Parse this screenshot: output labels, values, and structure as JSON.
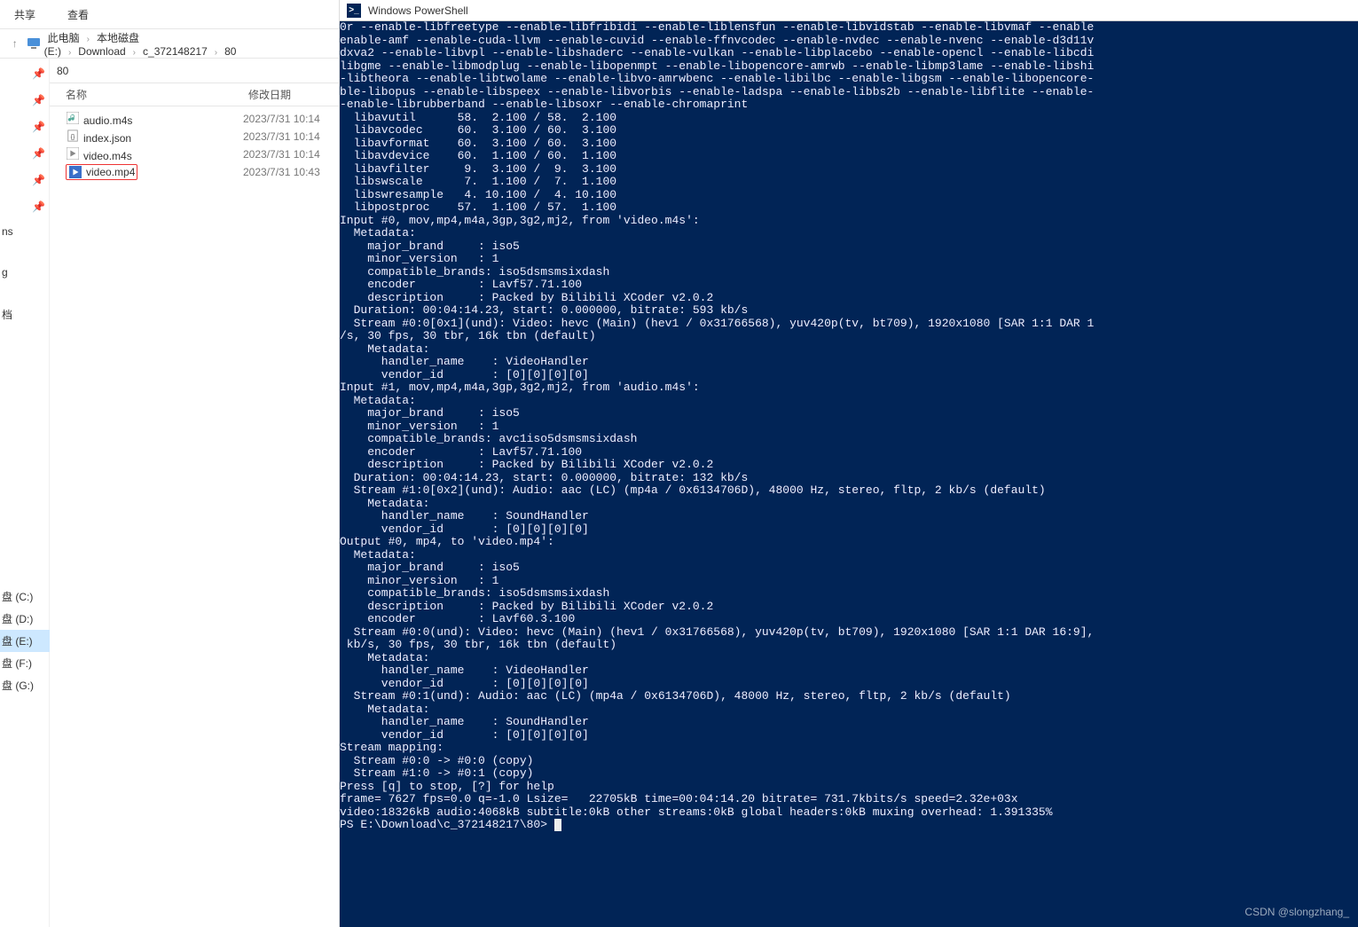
{
  "explorer": {
    "ribbon": {
      "share": "共享",
      "view": "查看"
    },
    "breadcrumbs": [
      "此电脑",
      "本地磁盘 (E:)",
      "Download",
      "c_372148217",
      "80"
    ],
    "tab": "80",
    "columns": {
      "name": "名称",
      "date": "修改日期"
    },
    "files": [
      {
        "icon": "audio",
        "name": "audio.m4s",
        "date": "2023/7/31 10:14"
      },
      {
        "icon": "json",
        "name": "index.json",
        "date": "2023/7/31 10:14"
      },
      {
        "icon": "video",
        "name": "video.m4s",
        "date": "2023/7/31 10:14"
      },
      {
        "icon": "mp4",
        "name": "video.mp4",
        "date": "2023/7/31 10:43",
        "highlight": true
      }
    ],
    "sidebar_labels": {
      "ns": "ns",
      "g": "g",
      "dang": "档"
    },
    "drives": [
      {
        "label": "(C:)"
      },
      {
        "label": "(D:)"
      },
      {
        "label": "(E:)",
        "selected": true
      },
      {
        "label": "(F:)"
      },
      {
        "label": "(G:)"
      }
    ]
  },
  "powershell": {
    "title": "Windows PowerShell",
    "output": "0r --enable-libfreetype --enable-libfribidi --enable-liblensfun --enable-libvidstab --enable-libvmaf --enable\nenable-amf --enable-cuda-llvm --enable-cuvid --enable-ffnvcodec --enable-nvdec --enable-nvenc --enable-d3d11v\ndxva2 --enable-libvpl --enable-libshaderc --enable-vulkan --enable-libplacebo --enable-opencl --enable-libcdi\nlibgme --enable-libmodplug --enable-libopenmpt --enable-libopencore-amrwb --enable-libmp3lame --enable-libshi\n-libtheora --enable-libtwolame --enable-libvo-amrwbenc --enable-libilbc --enable-libgsm --enable-libopencore-\nble-libopus --enable-libspeex --enable-libvorbis --enable-ladspa --enable-libbs2b --enable-libflite --enable-\n-enable-librubberband --enable-libsoxr --enable-chromaprint\n  libavutil      58.  2.100 / 58.  2.100\n  libavcodec     60.  3.100 / 60.  3.100\n  libavformat    60.  3.100 / 60.  3.100\n  libavdevice    60.  1.100 / 60.  1.100\n  libavfilter     9.  3.100 /  9.  3.100\n  libswscale      7.  1.100 /  7.  1.100\n  libswresample   4. 10.100 /  4. 10.100\n  libpostproc    57.  1.100 / 57.  1.100\nInput #0, mov,mp4,m4a,3gp,3g2,mj2, from 'video.m4s':\n  Metadata:\n    major_brand     : iso5\n    minor_version   : 1\n    compatible_brands: iso5dsmsmsixdash\n    encoder         : Lavf57.71.100\n    description     : Packed by Bilibili XCoder v2.0.2\n  Duration: 00:04:14.23, start: 0.000000, bitrate: 593 kb/s\n  Stream #0:0[0x1](und): Video: hevc (Main) (hev1 / 0x31766568), yuv420p(tv, bt709), 1920x1080 [SAR 1:1 DAR 1\n/s, 30 fps, 30 tbr, 16k tbn (default)\n    Metadata:\n      handler_name    : VideoHandler\n      vendor_id       : [0][0][0][0]\nInput #1, mov,mp4,m4a,3gp,3g2,mj2, from 'audio.m4s':\n  Metadata:\n    major_brand     : iso5\n    minor_version   : 1\n    compatible_brands: avc1iso5dsmsmsixdash\n    encoder         : Lavf57.71.100\n    description     : Packed by Bilibili XCoder v2.0.2\n  Duration: 00:04:14.23, start: 0.000000, bitrate: 132 kb/s\n  Stream #1:0[0x2](und): Audio: aac (LC) (mp4a / 0x6134706D), 48000 Hz, stereo, fltp, 2 kb/s (default)\n    Metadata:\n      handler_name    : SoundHandler\n      vendor_id       : [0][0][0][0]\nOutput #0, mp4, to 'video.mp4':\n  Metadata:\n    major_brand     : iso5\n    minor_version   : 1\n    compatible_brands: iso5dsmsmsixdash\n    description     : Packed by Bilibili XCoder v2.0.2\n    encoder         : Lavf60.3.100\n  Stream #0:0(und): Video: hevc (Main) (hev1 / 0x31766568), yuv420p(tv, bt709), 1920x1080 [SAR 1:1 DAR 16:9],\n kb/s, 30 fps, 30 tbr, 16k tbn (default)\n    Metadata:\n      handler_name    : VideoHandler\n      vendor_id       : [0][0][0][0]\n  Stream #0:1(und): Audio: aac (LC) (mp4a / 0x6134706D), 48000 Hz, stereo, fltp, 2 kb/s (default)\n    Metadata:\n      handler_name    : SoundHandler\n      vendor_id       : [0][0][0][0]\nStream mapping:\n  Stream #0:0 -> #0:0 (copy)\n  Stream #1:0 -> #0:1 (copy)\nPress [q] to stop, [?] for help\nframe= 7627 fps=0.0 q=-1.0 Lsize=   22705kB time=00:04:14.20 bitrate= 731.7kbits/s speed=2.32e+03x\nvideo:18326kB audio:4068kB subtitle:0kB other streams:0kB global headers:0kB muxing overhead: 1.391335%",
    "prompt": "PS E:\\Download\\c_372148217\\80>"
  },
  "watermark": "CSDN @slongzhang_"
}
